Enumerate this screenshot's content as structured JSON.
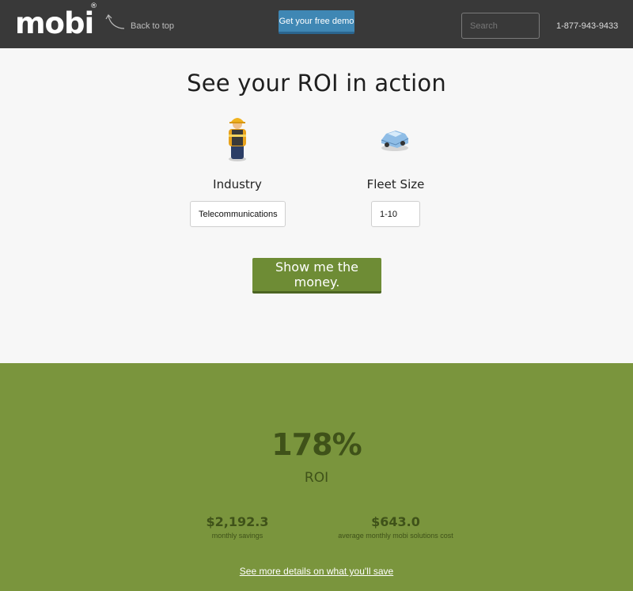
{
  "header": {
    "logo_text": "mobi",
    "logo_mark": "®",
    "back_link": "Back to top",
    "demo_button": "Get your free demo",
    "search_placeholder": "Search",
    "phone": "1-877-943-9433"
  },
  "calculator": {
    "title": "See your ROI in action",
    "industry_label": "Industry",
    "industry_value": "Telecommunications",
    "industry_icon": "worker-icon",
    "fleet_label": "Fleet Size",
    "fleet_value": "1-10",
    "fleet_icon": "car-icon",
    "submit_button": "Show me the money."
  },
  "results": {
    "roi_value": "178%",
    "roi_label": "ROI",
    "monthly_savings_value": "$2,192.3",
    "monthly_savings_label": "monthly savings",
    "monthly_cost_value": "$643.0",
    "monthly_cost_label": "average monthly mobi solutions cost",
    "details_link": "See more details on what you'll save"
  },
  "colors": {
    "header_bg": "#393939",
    "demo_button": "#3f87b4",
    "accent_green": "#6e8c35",
    "results_bg": "#7a953d",
    "results_text": "#3f5219"
  }
}
